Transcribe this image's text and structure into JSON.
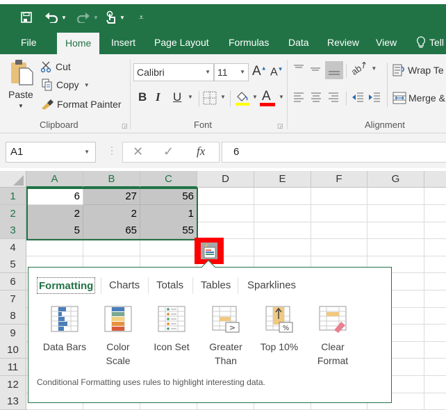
{
  "quick_access": {
    "save_icon": "save-icon",
    "undo_icon": "undo-icon",
    "redo_icon": "redo-icon",
    "touch_mode_icon": "touch-mode-icon",
    "customize_icon": "customize-qat-icon"
  },
  "tabs": [
    {
      "label": "File"
    },
    {
      "label": "Home",
      "active": true
    },
    {
      "label": "Insert"
    },
    {
      "label": "Page Layout"
    },
    {
      "label": "Formulas"
    },
    {
      "label": "Data"
    },
    {
      "label": "Review"
    },
    {
      "label": "View"
    },
    {
      "label": "Tell"
    }
  ],
  "ribbon": {
    "clipboard": {
      "paste": "Paste",
      "cut": "Cut",
      "copy": "Copy",
      "format_painter": "Format Painter",
      "label": "Clipboard"
    },
    "font": {
      "font_name": "Calibri",
      "font_size": "11",
      "grow": "A",
      "shrink": "A",
      "bold": "B",
      "italic": "I",
      "underline": "U",
      "font_color_letter": "A",
      "fill_color": "#ffff00",
      "font_color": "#ff0000",
      "label": "Font"
    },
    "alignment": {
      "wrap_text": "Wrap Te",
      "merge": "Merge &",
      "label": "Alignment"
    }
  },
  "formula_bar": {
    "name_box": "A1",
    "cancel": "✕",
    "enter": "✓",
    "fx": "fx",
    "value": "6"
  },
  "sheet": {
    "columns": [
      "A",
      "B",
      "C",
      "D",
      "E",
      "F",
      "G"
    ],
    "rows": [
      "1",
      "2",
      "3",
      "4",
      "5",
      "6",
      "7",
      "8",
      "9",
      "10",
      "11",
      "12",
      "13"
    ],
    "cells": [
      [
        "6",
        "27",
        "56"
      ],
      [
        "2",
        "2",
        "1"
      ],
      [
        "5",
        "65",
        "55"
      ]
    ]
  },
  "quick_analysis": {
    "icon": "quick-analysis-icon",
    "tabs": [
      "Formatting",
      "Charts",
      "Totals",
      "Tables",
      "Sparklines"
    ],
    "active_tab": "Formatting",
    "items": [
      {
        "label1": "Data Bars",
        "label2": "",
        "icon": "data-bars-icon"
      },
      {
        "label1": "Color",
        "label2": "Scale",
        "icon": "color-scale-icon"
      },
      {
        "label1": "Icon Set",
        "label2": "",
        "icon": "icon-set-icon"
      },
      {
        "label1": "Greater",
        "label2": "Than",
        "icon": "greater-than-icon"
      },
      {
        "label1": "Top 10%",
        "label2": "",
        "icon": "top-10-icon"
      },
      {
        "label1": "Clear",
        "label2": "Format",
        "icon": "clear-format-icon"
      }
    ],
    "footer": "Conditional Formatting uses rules to highlight interesting data."
  },
  "colors": {
    "brand_green": "#217346",
    "highlight_red": "#ff0000",
    "selection_gray": "#c6c6c6"
  }
}
